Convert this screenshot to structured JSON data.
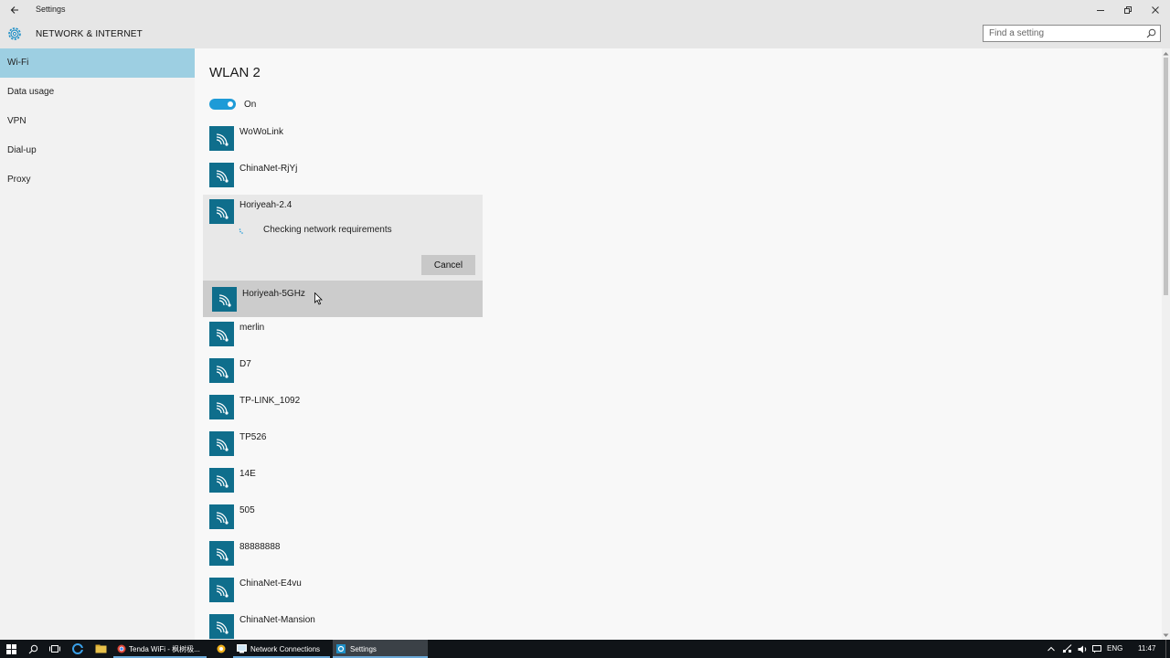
{
  "window": {
    "app_title": "Settings",
    "section_title": "NETWORK & INTERNET",
    "search_placeholder": "Find a setting"
  },
  "sidebar": {
    "items": [
      {
        "label": "Wi-Fi",
        "active": true
      },
      {
        "label": "Data usage"
      },
      {
        "label": "VPN"
      },
      {
        "label": "Dial-up"
      },
      {
        "label": "Proxy"
      }
    ]
  },
  "main": {
    "title": "WLAN 2",
    "toggle_label": "On",
    "networks": [
      {
        "ssid": "WoWoLink"
      },
      {
        "ssid": "ChinaNet-RjYj"
      },
      {
        "ssid": "Horiyeah-2.4",
        "status": "Checking network requirements",
        "action": "Cancel"
      },
      {
        "ssid": "Horiyeah-5GHz"
      },
      {
        "ssid": "merlin"
      },
      {
        "ssid": "D7"
      },
      {
        "ssid": "TP-LINK_1092"
      },
      {
        "ssid": "TP526"
      },
      {
        "ssid": "14E"
      },
      {
        "ssid": "505"
      },
      {
        "ssid": "88888888"
      },
      {
        "ssid": "ChinaNet-E4vu"
      },
      {
        "ssid": "ChinaNet-Mansion"
      }
    ]
  },
  "taskbar": {
    "apps": [
      {
        "label": "Tenda WiFi - 枫树极..."
      },
      {
        "label": "Network Connections"
      },
      {
        "label": "Settings"
      }
    ],
    "language": "ENG",
    "time": "11:47"
  },
  "colors": {
    "accent": "#1e9bd7",
    "selected_nav": "#9dcfe2",
    "wifi_tile": "#0f6e8c",
    "taskbar": "#101418"
  }
}
